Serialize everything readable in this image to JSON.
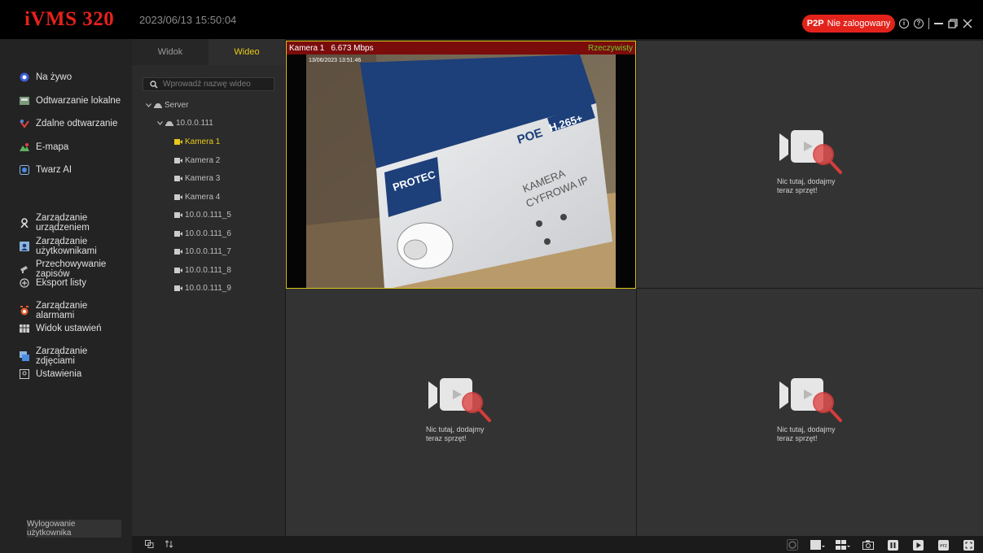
{
  "app": {
    "logo": "iVMS 320",
    "datetime": "2023/06/13 15:50:04"
  },
  "p2p": {
    "prefix": "P2P",
    "status": "Nie zalogowany"
  },
  "nav": {
    "items": [
      {
        "label": "Na żywo",
        "icon": "live-icon"
      },
      {
        "label": "Odtwarzanie lokalne",
        "icon": "local-playback-icon"
      },
      {
        "label": "Zdalne odtwarzanie",
        "icon": "remote-playback-icon"
      },
      {
        "label": "E-mapa",
        "icon": "emap-icon"
      },
      {
        "label": "Twarz AI",
        "icon": "face-ai-icon"
      }
    ],
    "items2": [
      {
        "label": "Zarządzanie urządzeniem",
        "icon": "device-icon"
      },
      {
        "label": "Zarządzanie użytkownikami",
        "icon": "user-icon"
      },
      {
        "label": "Przechowywanie zapisów",
        "icon": "storage-icon"
      },
      {
        "label": "Eksport listy",
        "icon": "export-icon"
      },
      {
        "label": "Zarządzanie alarmami",
        "icon": "alarm-icon"
      },
      {
        "label": "Widok ustawień",
        "icon": "view-settings-icon"
      },
      {
        "label": "Zarządzanie zdjęciami",
        "icon": "picture-icon"
      },
      {
        "label": "Ustawienia",
        "icon": "settings-icon"
      }
    ],
    "logout": "Wylogowanie użytkownika"
  },
  "tree": {
    "tabs": [
      "Widok",
      "Wideo"
    ],
    "active_tab": "Wideo",
    "search_placeholder": "Wprowadź nazwę wideo",
    "server": "Server",
    "device": "10.0.0.111",
    "channels": [
      "Kamera 1",
      "Kamera 2",
      "Kamera 3",
      "Kamera 4",
      "10.0.0.111_5",
      "10.0.0.111_6",
      "10.0.0.111_7",
      "10.0.0.111_8",
      "10.0.0.111_9"
    ],
    "selected": "Kamera 1"
  },
  "video": {
    "active_camera": "Kamera 1",
    "bitrate": "6.673 Mbps",
    "mode": "Rzeczywisty",
    "osd_timestamp": "13/06/2023 13:51:46",
    "empty_message": "Nic tutaj, dodajmy teraz sprzęt!"
  },
  "colors": {
    "accent_red": "#e3231b",
    "selected_yellow": "#e8c91a",
    "realtime_green": "#6ed12a",
    "header_red": "#7a0c0c"
  }
}
